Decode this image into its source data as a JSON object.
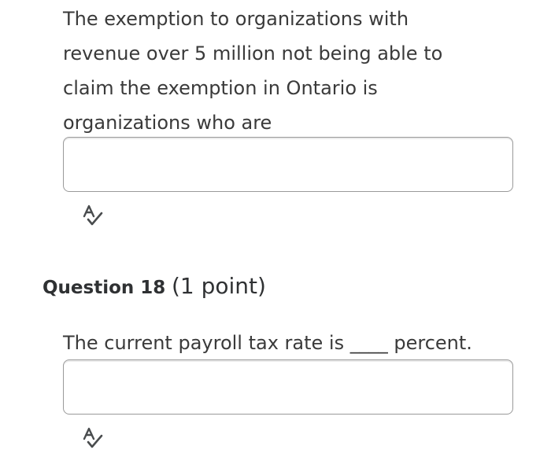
{
  "question_17": {
    "prompt_line_1": "The exemption to organizations with",
    "prompt_line_2": "revenue over 5 million not being able to",
    "prompt_line_3": "claim the exemption in Ontario is",
    "prompt_line_4": "organizations who are",
    "answer_value": "",
    "spellcheck_icon": "spellcheck-icon"
  },
  "question_18": {
    "number_label": "Question 18",
    "points_label": "(1 point)",
    "prompt": "The current payroll tax rate is ____ percent.",
    "answer_value": "",
    "spellcheck_icon": "spellcheck-icon"
  }
}
